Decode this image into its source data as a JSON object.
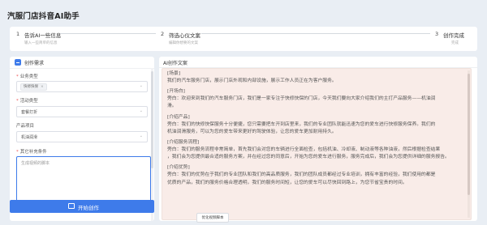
{
  "app": {
    "title": "汽服门店抖音AI助手"
  },
  "steps": [
    {
      "num": "1",
      "title": "告诉AI一些信息",
      "desc": "输入一些简单的信息"
    },
    {
      "num": "2",
      "title": "筛选心仪文案",
      "desc": "编辑你想要的文案"
    },
    {
      "num": "3",
      "title": "创作完成",
      "desc": "完成"
    }
  ],
  "left": {
    "panel_title": "创作需求",
    "fields": {
      "business_type": {
        "label": "业务类型",
        "tag": "快修快保",
        "tag_remove": "×"
      },
      "activity_type": {
        "label": "活动类型",
        "value": "套餐打折"
      },
      "product": {
        "label": "产品项目",
        "value": "机油润滑"
      },
      "conditions": {
        "label": "其它补充条件",
        "placeholder": "生成视频的脚本"
      }
    },
    "chevron": "⌄",
    "start_button": {
      "label": "开始创作"
    }
  },
  "right": {
    "panel_title": "AI创作文案",
    "sections": [
      {
        "head": "[场景]",
        "lines": [
          "我们的汽车服务门店，展示门店外观和内部设施，展示工作人员正在为客户服务。"
        ]
      },
      {
        "head": "[开场白]",
        "lines": [
          "旁白：欢迎来到我们的汽车服务门店，我们是一家专注于快修快保的门店，今天我们要向大家介绍我们的主打产品服务——机油润",
          "滑。"
        ]
      },
      {
        "head": "[介绍产品]",
        "lines": [
          "旁白：我们的快修快保服务十分便捷，您只需要把车开到店里来，我们的专业团队就能迅速为您的爱车进行快修服务保养。我们的",
          "机油润滑服务，可以为您的爱车带来更好的驾驶体验，让您的爱车更加耐用持久。"
        ]
      },
      {
        "head": "[介绍服务流程]",
        "lines": [
          "旁白：我们的服务流程非常简单，首先我们会对您的车辆进行全面检查，包括机油、冷却液、制动液等各种油液，然后根据检查结果",
          "，我们会为您提供最合适的服务方案，并在经过您的同意后，开始为您的爱车进行服务，服务完成后，我们会为您提供详细的服务报告。"
        ]
      },
      {
        "head": "[介绍优势]",
        "lines": [
          "旁白：我们的优势在于我们的专业团队和我们的高品质服务，我们的团队成员都经过专业培训，拥有丰富的经验，我们使用的都是",
          "优质的产品，我们的服务价格合理透明，我们的服务时间短，让您的爱车可以尽快回到路上，为您节省宝贵的时间。"
        ]
      }
    ],
    "optimize_button": {
      "label": "优化视频脚本"
    }
  }
}
